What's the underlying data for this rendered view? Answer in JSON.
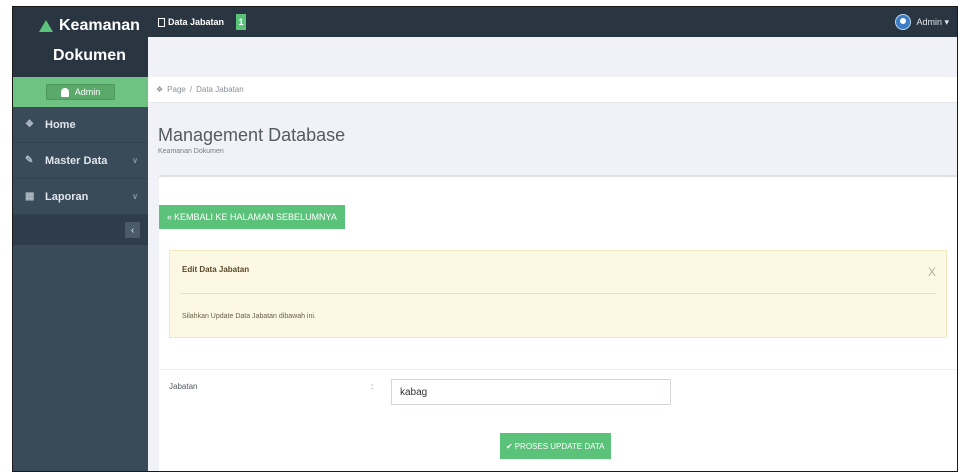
{
  "brand": {
    "line1": "Keamanan",
    "line2": "Dokumen"
  },
  "user_box": {
    "label": "Admin"
  },
  "sidebar": {
    "items": [
      {
        "icon": "home-icon",
        "label": "Home",
        "has_chevron": false
      },
      {
        "icon": "edit-icon",
        "label": "Master Data",
        "has_chevron": true
      },
      {
        "icon": "calendar-icon",
        "label": "Laporan",
        "has_chevron": true
      }
    ],
    "collapse_glyph": "‹"
  },
  "topbar": {
    "tab_label": "Data Jabatan",
    "badge": "1",
    "user_label": "Admin ▾"
  },
  "breadcrumb": {
    "home_label": "Page",
    "separator": "/",
    "current": "Data Jabatan"
  },
  "page": {
    "title": "Management Database",
    "subtitle": "Keamanan Dokumen"
  },
  "back_button": {
    "label": "KEMBALI KE HALAMAN SEBELUMNYA"
  },
  "alert": {
    "title": "Edit Data Jabatan",
    "close": "X",
    "body": "Silahkan Update Data Jabatan dibawah ini."
  },
  "form": {
    "field_label": "Jabatan",
    "colon": ":",
    "field_value": "kabag"
  },
  "submit_button": {
    "label": "PROSES UPDATE DATA"
  },
  "colors": {
    "accent_green": "#5bc27a",
    "sidebar_bg": "#394a59",
    "topbar_bg": "#2a3542",
    "alert_bg": "#fcf8e3"
  }
}
